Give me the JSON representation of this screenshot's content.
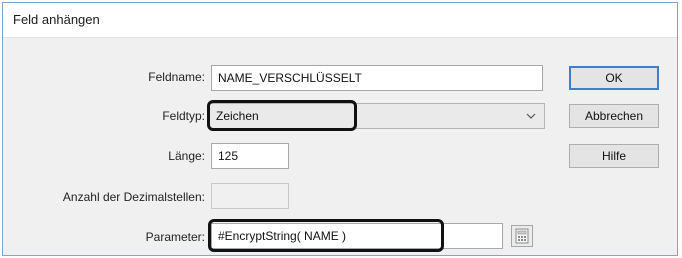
{
  "dialog": {
    "title": "Feld anhängen"
  },
  "form": {
    "fieldname_label": "Feldname:",
    "fieldname_value": "NAME_VERSCHLÜSSELT",
    "fieldtype_label": "Feldtyp:",
    "fieldtype_value": "Zeichen",
    "length_label": "Länge:",
    "length_value": "125",
    "decimals_label": "Anzahl der Dezimalstellen:",
    "decimals_value": "",
    "parameter_label": "Parameter:",
    "parameter_value": "#EncryptString( NAME )"
  },
  "buttons": {
    "ok": "OK",
    "cancel": "Abbrechen",
    "help": "Hilfe"
  },
  "icons": {
    "dropdown": "chevron-down-icon",
    "expression_builder": "calculator-icon"
  },
  "colors": {
    "highlight": "#111111",
    "default_button_border": "#3c7fd0"
  }
}
